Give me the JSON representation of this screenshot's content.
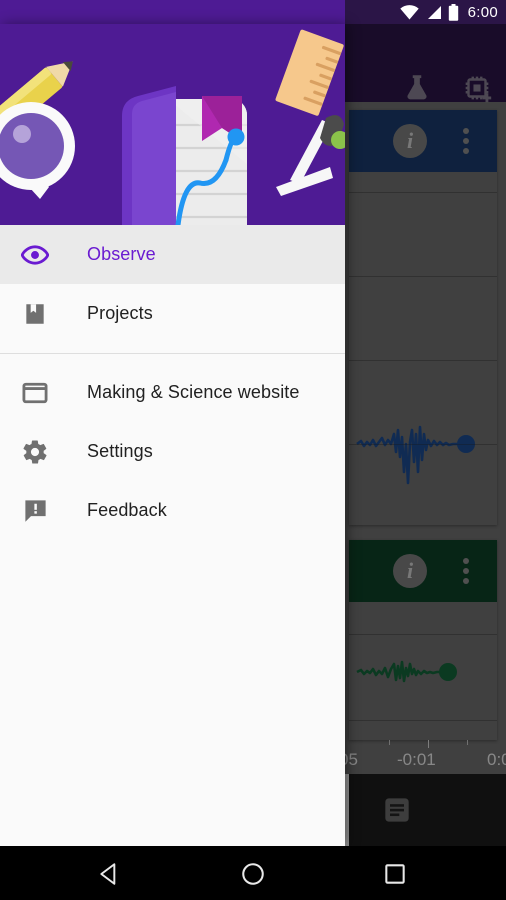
{
  "status_bar": {
    "clock": "6:00",
    "icons": [
      "wifi-icon",
      "cell-signal-icon",
      "battery-icon"
    ]
  },
  "background_app": {
    "toolbar": {
      "background_color": "#2b1547",
      "actions": [
        {
          "name": "flask-icon",
          "label": "Experiments"
        },
        {
          "name": "add-sensor-icon",
          "label": "Add sensor"
        }
      ]
    },
    "cards": [
      {
        "name": "sensor-card-blue",
        "header_color": "#1b3a6b",
        "trace_color": "#1d4b8f",
        "info_label": "i",
        "overflow_label": "⋮"
      },
      {
        "name": "sensor-card-green",
        "header_color": "#0d4026",
        "trace_color": "#14653a",
        "info_label": "i",
        "overflow_label": "⋮"
      }
    ],
    "axis": {
      "labels": [
        "05",
        "-0:01",
        "0:0"
      ]
    },
    "bottom_bar": {
      "background_color": "#1c1c1c",
      "action": {
        "name": "notes-icon",
        "label": "Notes"
      }
    }
  },
  "drawer": {
    "header": {
      "background_color": "#4e1b94",
      "illustration": "science-tools-illustration"
    },
    "accent_color": "#6a1bd1",
    "groups": [
      {
        "items": [
          {
            "name": "sidebar-item-observe",
            "label": "Observe",
            "icon": "eye-icon",
            "selected": true
          },
          {
            "name": "sidebar-item-projects",
            "label": "Projects",
            "icon": "book-bookmark-icon",
            "selected": false
          }
        ]
      },
      {
        "items": [
          {
            "name": "sidebar-item-making-science-website",
            "label": "Making & Science website",
            "icon": "window-icon",
            "selected": false
          },
          {
            "name": "sidebar-item-settings",
            "label": "Settings",
            "icon": "gear-icon",
            "selected": false
          },
          {
            "name": "sidebar-item-feedback",
            "label": "Feedback",
            "icon": "feedback-icon",
            "selected": false
          }
        ]
      }
    ]
  },
  "navbar": {
    "buttons": [
      {
        "name": "nav-back-button",
        "label": "Back"
      },
      {
        "name": "nav-home-button",
        "label": "Home"
      },
      {
        "name": "nav-recents-button",
        "label": "Recents"
      }
    ]
  }
}
